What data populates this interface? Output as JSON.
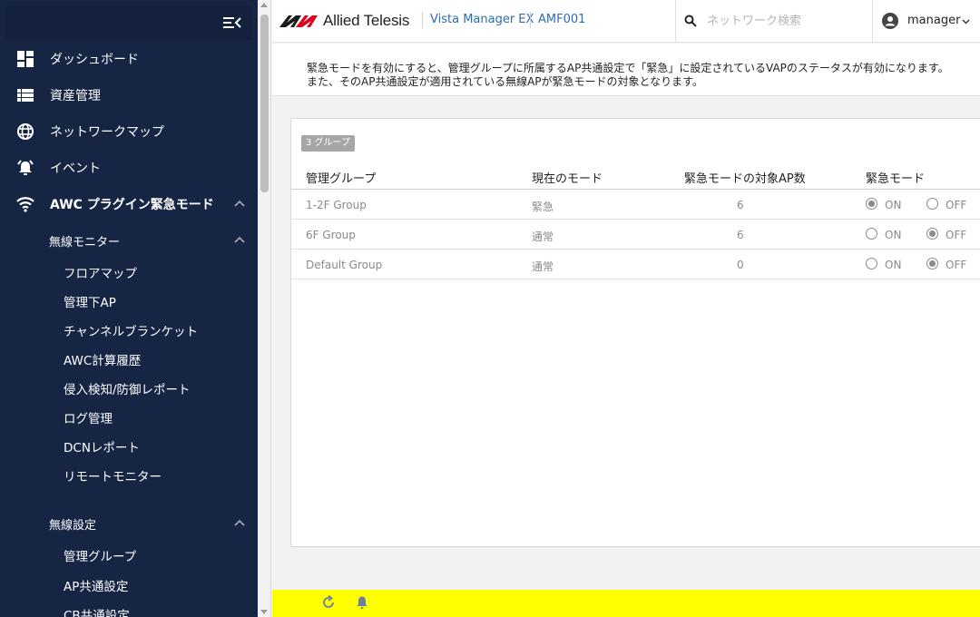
{
  "sidebar": {
    "items": [
      {
        "label": "ダッシュボード",
        "icon": "dashboard-icon"
      },
      {
        "label": "資産管理",
        "icon": "list-icon"
      },
      {
        "label": "ネットワークマップ",
        "icon": "globe-icon"
      },
      {
        "label": "イベント",
        "icon": "alarm-icon"
      },
      {
        "label": "AWC プラグイン緊急モード",
        "icon": "wifi-icon"
      }
    ],
    "wireless_monitor": {
      "label": "無線モニター",
      "children": [
        "フロアマップ",
        "管理下AP",
        "チャンネルブランケット",
        "AWC計算履歴",
        "侵入検知/防御レポート",
        "ログ管理",
        "DCNレポート",
        "リモートモニター"
      ]
    },
    "wireless_settings": {
      "label": "無線設定",
      "children": [
        "管理グループ",
        "AP共通設定",
        "CB共通設定"
      ]
    }
  },
  "header": {
    "brand": "Allied Telesis",
    "product": "Vista Manager EX",
    "node": "AMF001",
    "search_placeholder": "ネットワーク検索",
    "user": "manager"
  },
  "info": {
    "line1": "緊急モードを有効にすると、管理グループに所属するAP共通設定で「緊急」に設定されているVAPのステータスが有効になります。",
    "line2": "また、そのAP共通設定が適用されている無線APが緊急モードの対象となります。"
  },
  "table": {
    "badge": "3 グループ",
    "headers": [
      "管理グループ",
      "現在のモード",
      "緊急モードの対象AP数",
      "緊急モード"
    ],
    "on_label": "ON",
    "off_label": "OFF",
    "rows": [
      {
        "group": "1-2F Group",
        "mode": "緊急",
        "count": "6",
        "emergency": "on"
      },
      {
        "group": "6F Group",
        "mode": "通常",
        "count": "6",
        "emergency": "off"
      },
      {
        "group": "Default Group",
        "mode": "通常",
        "count": "0",
        "emergency": "off"
      }
    ]
  },
  "colors": {
    "sidebar_bg": "#162544",
    "link": "#2b6cb0",
    "footer_bg": "#ffff00",
    "logo_red": "#e0001b"
  },
  "footer": {
    "icons": [
      "refresh-icon",
      "bell-icon"
    ]
  }
}
